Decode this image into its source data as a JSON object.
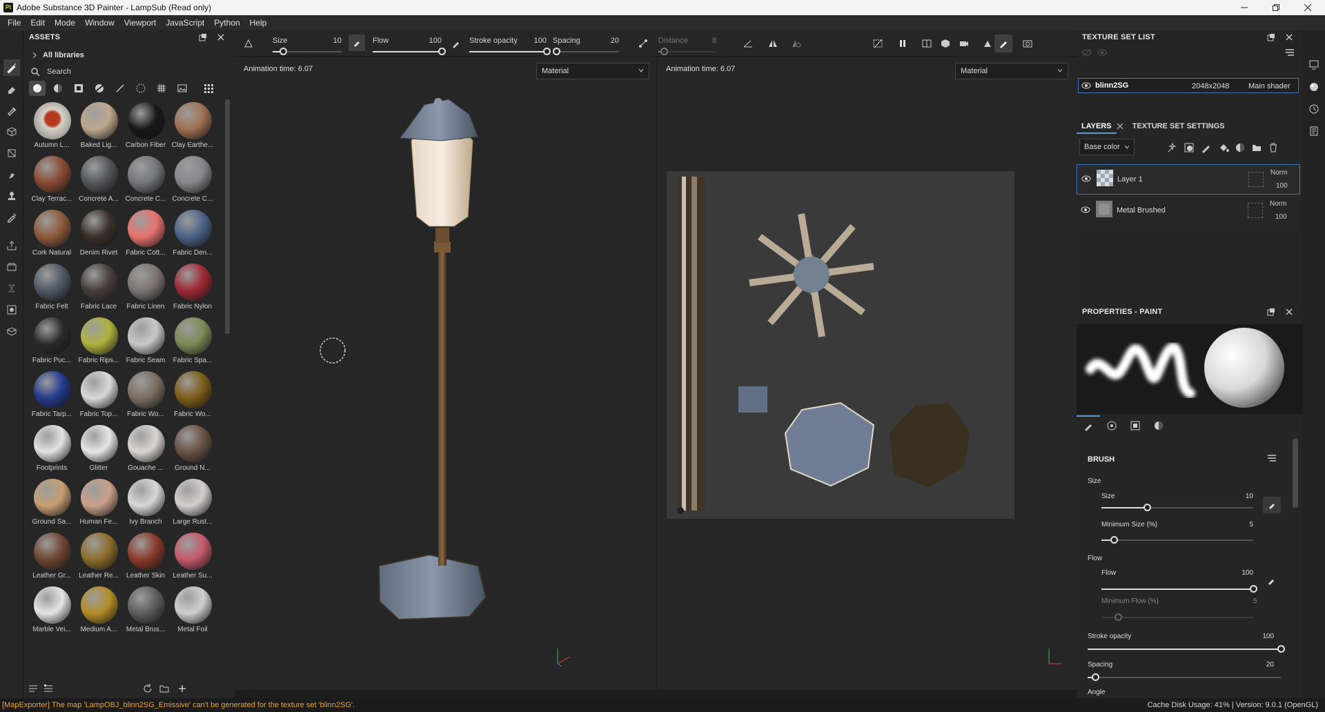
{
  "window": {
    "title": "Adobe Substance 3D Painter - LampSub (Read only)",
    "logo_text": "Pt"
  },
  "menu": [
    "File",
    "Edit",
    "Mode",
    "Window",
    "Viewport",
    "JavaScript",
    "Python",
    "Help"
  ],
  "assets": {
    "title": "ASSETS",
    "library": "All libraries",
    "search_placeholder": "Search",
    "items": [
      {
        "label": "Autumn L...",
        "color": "#d8d2c8",
        "accent": "#b33a1e"
      },
      {
        "label": "Baked Lig...",
        "color": "#bfa88e"
      },
      {
        "label": "Carbon Fiber",
        "color": "#181818"
      },
      {
        "label": "Clay Earthe...",
        "color": "#a07152"
      },
      {
        "label": "Clay Terrac...",
        "color": "#8a4a33"
      },
      {
        "label": "Concrete A...",
        "color": "#55565a"
      },
      {
        "label": "Concrete C...",
        "color": "#75767a"
      },
      {
        "label": "Concrete C...",
        "color": "#87878a"
      },
      {
        "label": "Cork Natural",
        "color": "#8d5a3b"
      },
      {
        "label": "Denim Rivet",
        "color": "#3a2f2a"
      },
      {
        "label": "Fabric Cott...",
        "color": "#e8736e"
      },
      {
        "label": "Fabric Den...",
        "color": "#4c6286"
      },
      {
        "label": "Fabric Felt",
        "color": "#4f5967"
      },
      {
        "label": "Fabric Lace",
        "color": "#4a3e3e"
      },
      {
        "label": "Fabric Linen",
        "color": "#7d7373"
      },
      {
        "label": "Fabric Nylon",
        "color": "#9e2a35"
      },
      {
        "label": "Fabric Puc...",
        "color": "#2b2b2b"
      },
      {
        "label": "Fabric Rips...",
        "color": "#b0b23e"
      },
      {
        "label": "Fabric Seam",
        "color": "#c8c8c8"
      },
      {
        "label": "Fabric Spa...",
        "color": "#7c8a55"
      },
      {
        "label": "Fabric Tarp...",
        "color": "#233b8c"
      },
      {
        "label": "Fabric Top...",
        "color": "#d8d8d8"
      },
      {
        "label": "Fabric Wo...",
        "color": "#7a6e62"
      },
      {
        "label": "Fabric Wo...",
        "color": "#7c5d18"
      },
      {
        "label": "Footprints",
        "color": "#e2e2e2"
      },
      {
        "label": "Glitter",
        "color": "#e6e6e6"
      },
      {
        "label": "Gouache ...",
        "color": "#d9d6d2"
      },
      {
        "label": "Ground N...",
        "color": "#6a5245"
      },
      {
        "label": "Ground Sa...",
        "color": "#c69e72"
      },
      {
        "label": "Human Fe...",
        "color": "#c9a08a"
      },
      {
        "label": "Ivy Branch",
        "color": "#d8d8d8"
      },
      {
        "label": "Large Rust...",
        "color": "#d2cece"
      },
      {
        "label": "Leather Gr...",
        "color": "#6e4632"
      },
      {
        "label": "Leather Re...",
        "color": "#8c6c2c"
      },
      {
        "label": "Leather Skin",
        "color": "#8a3a2a"
      },
      {
        "label": "Leather Su...",
        "color": "#c45a6a"
      },
      {
        "label": "Marble Vei...",
        "color": "#e4e4e4"
      },
      {
        "label": "Medium A...",
        "color": "#b38d28"
      },
      {
        "label": "Metal Brus...",
        "color": "#5d5d5d"
      },
      {
        "label": "Metal Foil",
        "color": "#cfcfcf"
      }
    ]
  },
  "toolbar": {
    "size_label": "Size",
    "size_value": "10",
    "size_frac": 0.15,
    "flow_label": "Flow",
    "flow_value": "100",
    "flow_frac": 1.0,
    "opacity_label": "Stroke opacity",
    "opacity_value": "100",
    "opacity_frac": 1.0,
    "spacing_label": "Spacing",
    "spacing_value": "20",
    "spacing_frac": 0.05,
    "distance_label": "Distance",
    "distance_value": "8",
    "distance_frac": 0.1
  },
  "viewport3d": {
    "anim": "Animation time: 6.07",
    "mode": "Material"
  },
  "viewport2d": {
    "anim": "Animation time: 6.07",
    "mode": "Material"
  },
  "texture_set_list": {
    "title": "TEXTURE SET LIST",
    "set_name": "blinn2SG",
    "resolution": "2048x2048",
    "shader": "Main shader"
  },
  "layers_tabs": {
    "layers": "LAYERS",
    "settings": "TEXTURE SET SETTINGS",
    "channel": "Base color"
  },
  "layers": [
    {
      "name": "Layer 1",
      "blend": "Norm",
      "opacity": "100"
    },
    {
      "name": "Metal Brushed",
      "blend": "Norm",
      "opacity": "100"
    }
  ],
  "properties": {
    "title": "PROPERTIES - PAINT",
    "brush": "BRUSH",
    "size_group": "Size",
    "size_label": "Size",
    "size_value": "10",
    "size_frac": 0.3,
    "minsize_label": "Minimum Size (%)",
    "minsize_value": "5",
    "minsize_frac": 0.08,
    "flow_group": "Flow",
    "flow_label": "Flow",
    "flow_value": "100",
    "flow_frac": 1.0,
    "minflow_label": "Minimum Flow (%)",
    "minflow_value": "5",
    "opacity_label": "Stroke opacity",
    "opacity_value": "100",
    "opacity_frac": 1.0,
    "spacing_label": "Spacing",
    "spacing_value": "20",
    "spacing_frac": 0.04,
    "angle_label": "Angle"
  },
  "status": {
    "error": "[MapExporter] The map 'LampOBJ_blinn2SG_Emissive' can't be generated for the texture set 'blinn2SG'.",
    "info": "Cache Disk Usage:   41% | Version: 9.0.1 (OpenGL)"
  },
  "colors": {
    "accent": "#3c7ac9",
    "error": "#e8a33d"
  }
}
